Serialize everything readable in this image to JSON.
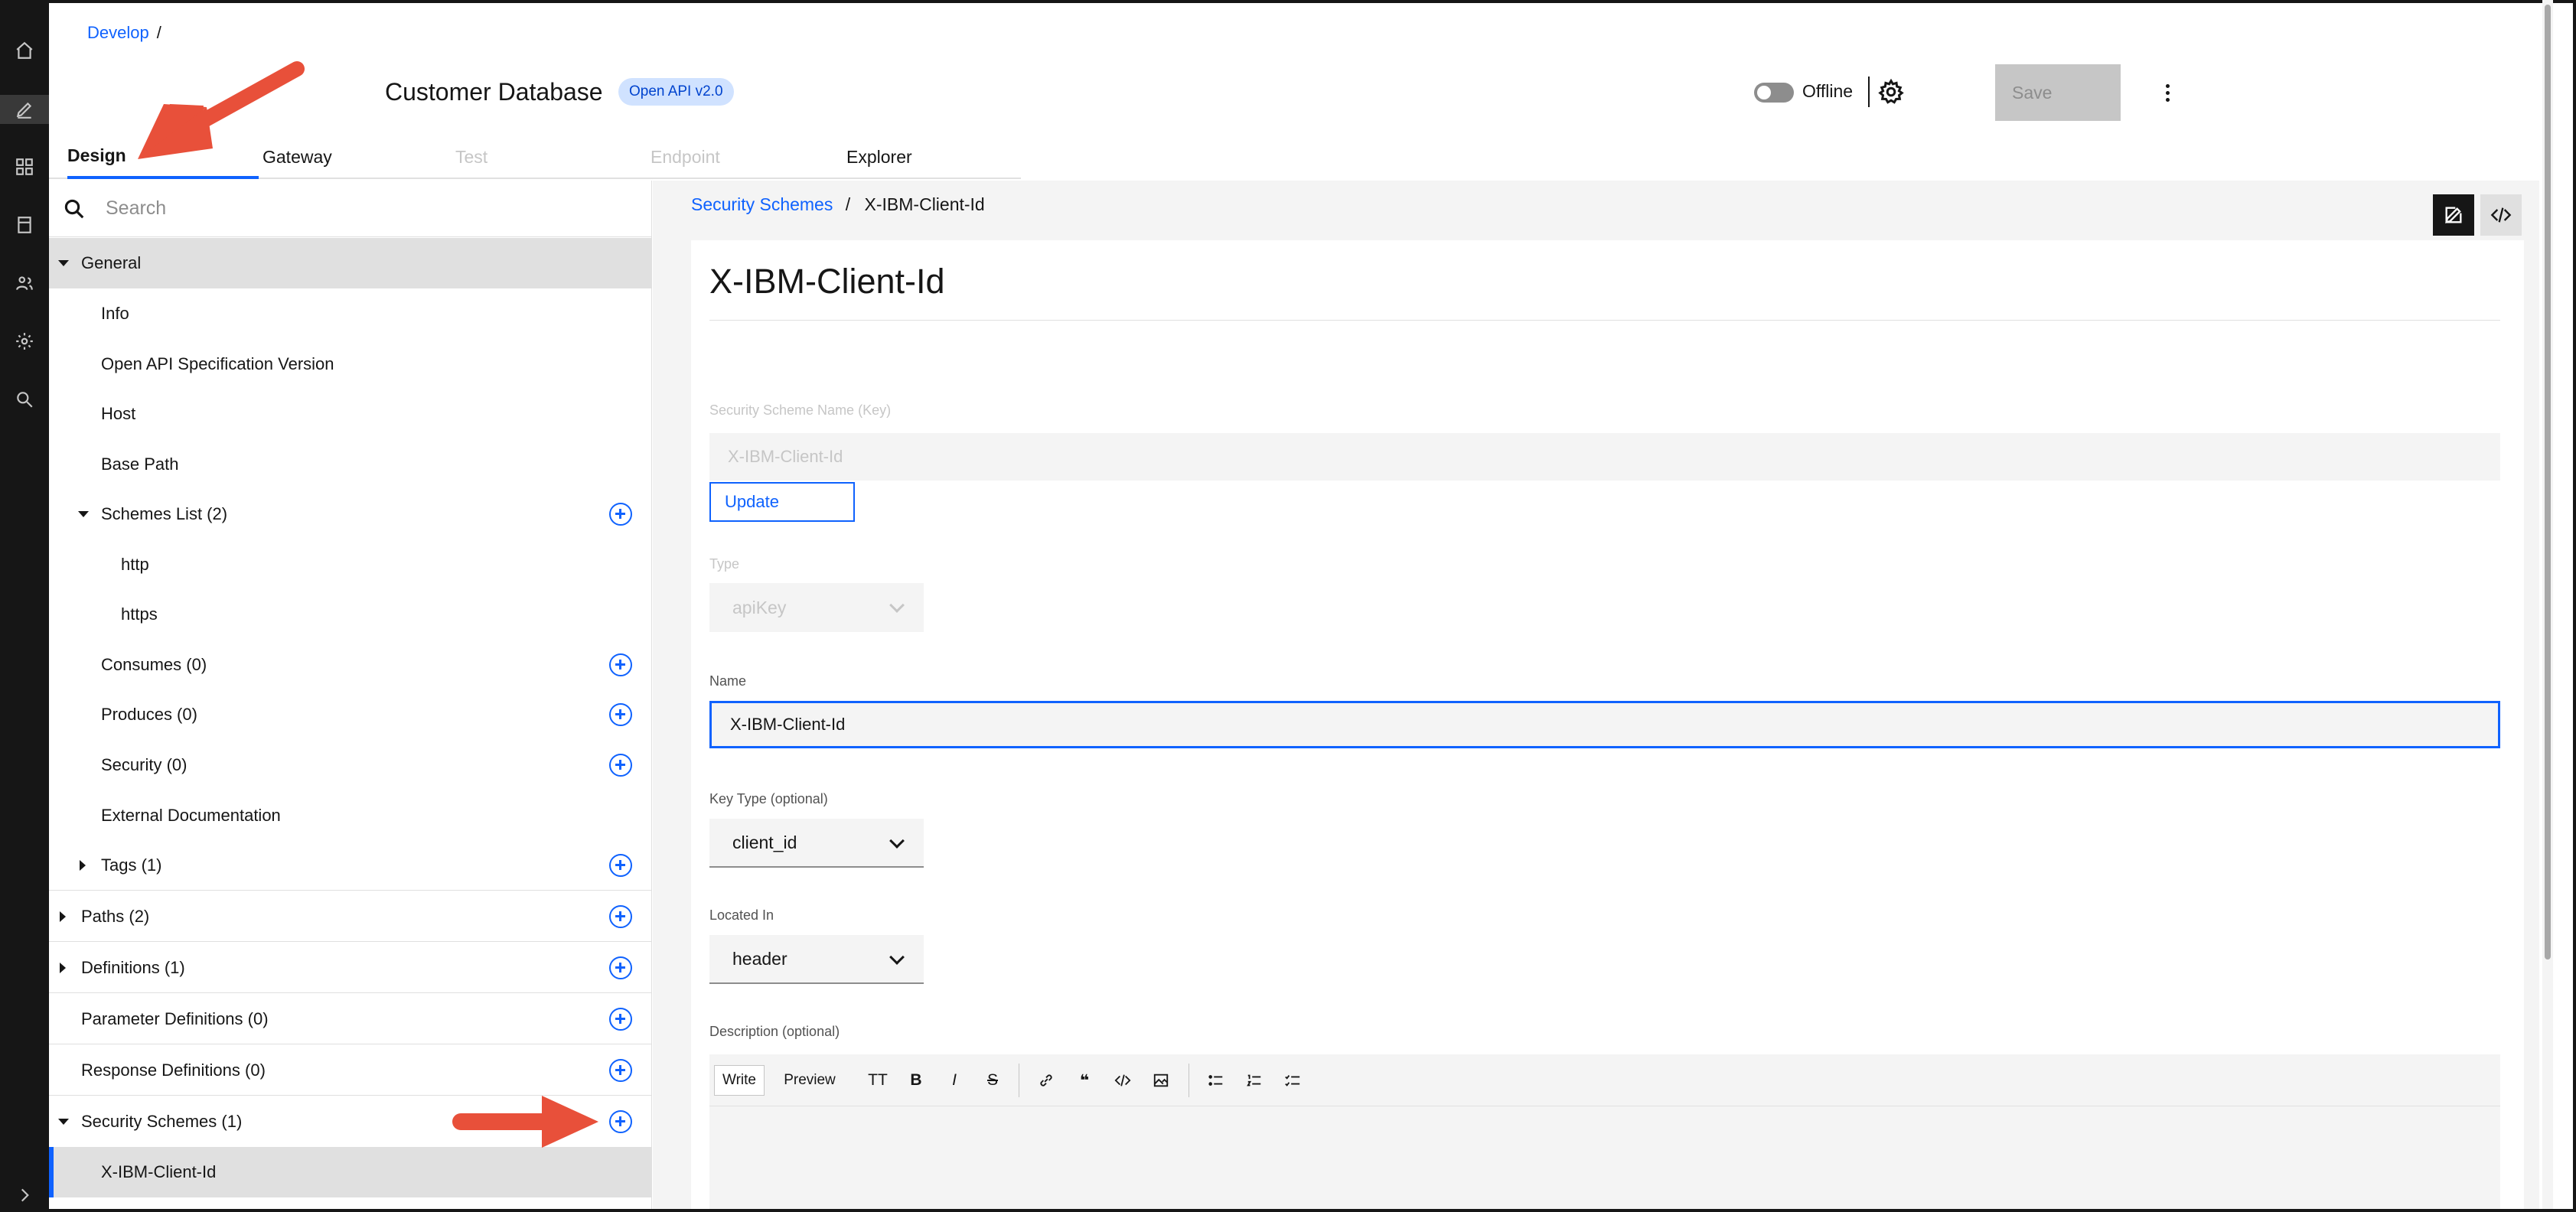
{
  "header": {
    "breadcrumb_root": "Develop",
    "breadcrumb_sep": "/",
    "api_title": "Customer Database",
    "api_badge": "Open API v2.0",
    "status_label": "Offline",
    "save_label": "Save"
  },
  "tabs": [
    {
      "label": "Design",
      "state": "active"
    },
    {
      "label": "Gateway",
      "state": "enabled"
    },
    {
      "label": "Test",
      "state": "disabled"
    },
    {
      "label": "Endpoint",
      "state": "disabled"
    },
    {
      "label": "Explorer",
      "state": "enabled"
    }
  ],
  "sidebar": {
    "search_placeholder": "Search",
    "items": [
      {
        "label": "General"
      },
      {
        "label": "Info"
      },
      {
        "label": "Open API Specification Version"
      },
      {
        "label": "Host"
      },
      {
        "label": "Base Path"
      },
      {
        "label": "Schemes List (2)"
      },
      {
        "label": "http"
      },
      {
        "label": "https"
      },
      {
        "label": "Consumes (0)"
      },
      {
        "label": "Produces (0)"
      },
      {
        "label": "Security (0)"
      },
      {
        "label": "External Documentation"
      },
      {
        "label": "Tags (1)"
      },
      {
        "label": "Paths (2)"
      },
      {
        "label": "Definitions (1)"
      },
      {
        "label": "Parameter Definitions (0)"
      },
      {
        "label": "Response Definitions (0)"
      },
      {
        "label": "Security Schemes (1)"
      },
      {
        "label": "X-IBM-Client-Id"
      }
    ]
  },
  "main": {
    "breadcrumb_parent": "Security Schemes",
    "breadcrumb_sep": "/",
    "breadcrumb_current": "X-IBM-Client-Id",
    "heading": "X-IBM-Client-Id",
    "scheme_name_label": "Security Scheme Name (Key)",
    "scheme_name_value": "X-IBM-Client-Id",
    "update_label": "Update",
    "type_label": "Type",
    "type_value": "apiKey",
    "name_label": "Name",
    "name_value": "X-IBM-Client-Id",
    "key_type_label": "Key Type (optional)",
    "key_type_value": "client_id",
    "located_in_label": "Located In",
    "located_in_value": "header",
    "description_label": "Description (optional)",
    "editor": {
      "write_tab": "Write",
      "preview_tab": "Preview",
      "heading_btn": "TT",
      "bold_btn": "B",
      "italic_btn": "I",
      "strike_btn": "S"
    }
  },
  "colors": {
    "accent": "#0f62fe",
    "annotation_arrow": "#e8503a",
    "rail": "#161616"
  }
}
